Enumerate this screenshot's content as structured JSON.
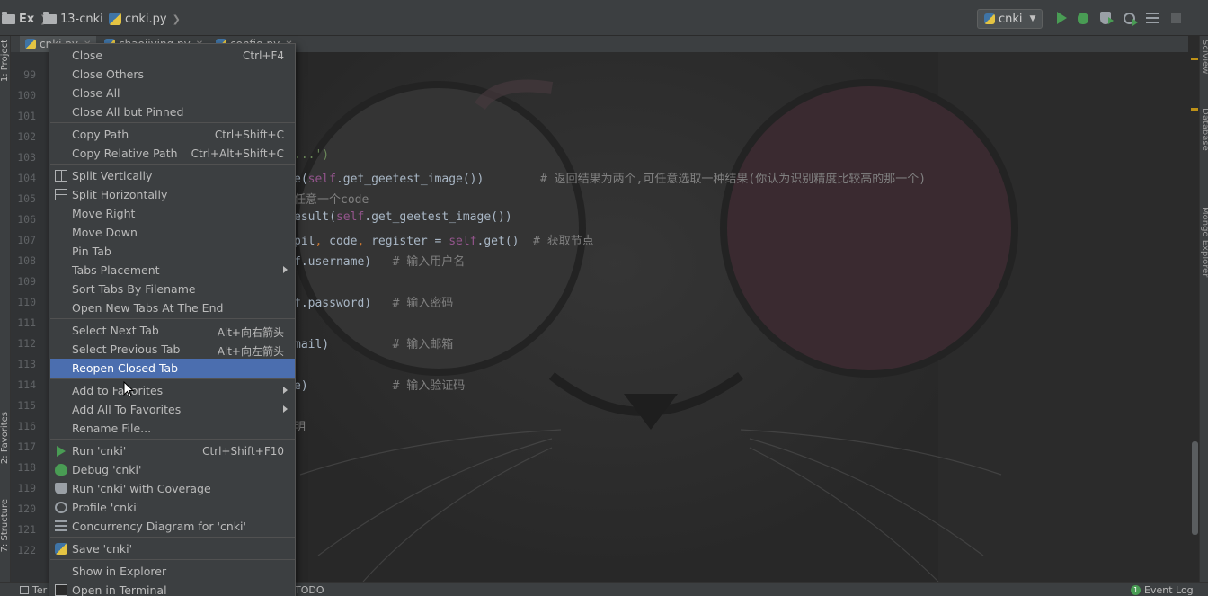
{
  "breadcrumb": [
    {
      "label": "Ex",
      "icon": "folder-icon"
    },
    {
      "label": "13-cnki",
      "icon": "folder-icon"
    },
    {
      "label": "cnki.py",
      "icon": "python-file-icon"
    }
  ],
  "toolbar": {
    "run_config": "cnki",
    "buttons": [
      "run-icon",
      "debug-icon",
      "coverage-icon",
      "profile-icon",
      "concurrency-icon",
      "stop-icon"
    ]
  },
  "tabs": [
    {
      "label": "cnki.py"
    },
    {
      "label": "chaojiying.py"
    },
    {
      "label": "config.py"
    }
  ],
  "left_tool_windows": [
    "1: Project",
    "2: Favorites",
    "7: Structure"
  ],
  "right_tool_windows": [
    "SciView",
    "Database",
    "Mongo Explorer"
  ],
  "gutter": {
    "lines": [
      "99",
      "100",
      "101",
      "102",
      "103",
      "104",
      "105",
      "106",
      "107",
      "108",
      "109",
      "110",
      "111",
      "112",
      "113",
      "114",
      "115",
      "116",
      "117",
      "118",
      "119",
      "120",
      "121",
      "122"
    ]
  },
  "code_lines": [
    {
      "parts": [
        {
          "t": "...')",
          "c": "str"
        }
      ]
    },
    {
      "parts": [
        {
          "t": "e(",
          "c": "plain"
        },
        {
          "t": "self",
          "c": "self"
        },
        {
          "t": ".get_geetest_image())        ",
          "c": "plain"
        },
        {
          "t": "# 返回结果为两个,可任意选取一种结果(你认为识别精度比较高的那一个)",
          "c": "cm"
        }
      ]
    },
    {
      "parts": [
        {
          "t": "任意一个code",
          "c": "cm"
        }
      ]
    },
    {
      "parts": [
        {
          "t": "esult(",
          "c": "plain"
        },
        {
          "t": "self",
          "c": "self"
        },
        {
          "t": ".get_geetest_image())",
          "c": "plain"
        }
      ]
    },
    {
      "parts": [
        {
          "t": "pil",
          "c": "plain"
        },
        {
          "t": ", ",
          "c": "kw"
        },
        {
          "t": "code",
          "c": "plain"
        },
        {
          "t": ", ",
          "c": "kw"
        },
        {
          "t": "register = ",
          "c": "plain"
        },
        {
          "t": "self",
          "c": "self"
        },
        {
          "t": ".get()  ",
          "c": "plain"
        },
        {
          "t": "# 获取节点",
          "c": "cm"
        }
      ]
    },
    {
      "parts": [
        {
          "t": "f.username)   ",
          "c": "plain"
        },
        {
          "t": "# 输入用户名",
          "c": "cm"
        }
      ]
    },
    {
      "parts": [
        {
          "t": "f.password)   ",
          "c": "plain"
        },
        {
          "t": "# 输入密码",
          "c": "cm"
        }
      ]
    },
    {
      "parts": [
        {
          "t": "mail)         ",
          "c": "plain"
        },
        {
          "t": "# 输入邮箱",
          "c": "cm"
        }
      ]
    },
    {
      "parts": [
        {
          "t": "e)            ",
          "c": "plain"
        },
        {
          "t": "# 输入验证码",
          "c": "cm"
        }
      ]
    },
    {
      "parts": [
        {
          "t": "明",
          "c": "cm"
        }
      ]
    }
  ],
  "context_menu": {
    "groups": [
      [
        {
          "label": "Close",
          "shortcut": "Ctrl+F4"
        },
        {
          "label": "Close Others"
        },
        {
          "label": "Close All"
        },
        {
          "label": "Close All but Pinned"
        }
      ],
      [
        {
          "label": "Copy Path",
          "shortcut": "Ctrl+Shift+C"
        },
        {
          "label": "Copy Relative Path",
          "shortcut": "Ctrl+Alt+Shift+C"
        }
      ],
      [
        {
          "label": "Split Vertically",
          "icon": "split-vertical-icon"
        },
        {
          "label": "Split Horizontally",
          "icon": "split-horizontal-icon"
        },
        {
          "label": "Move Right"
        },
        {
          "label": "Move Down"
        },
        {
          "label": "Pin Tab"
        },
        {
          "label": "Tabs Placement",
          "submenu": true
        },
        {
          "label": "Sort Tabs By Filename"
        },
        {
          "label": "Open New Tabs At The End"
        }
      ],
      [
        {
          "label": "Select Next Tab",
          "shortcut": "Alt+向右箭头"
        },
        {
          "label": "Select Previous Tab",
          "shortcut": "Alt+向左箭头"
        },
        {
          "label": "Reopen Closed Tab",
          "highlighted": true
        }
      ],
      [
        {
          "label": "Add to Favorites",
          "submenu": true
        },
        {
          "label": "Add All To Favorites",
          "submenu": true
        },
        {
          "label": "Rename File..."
        }
      ],
      [
        {
          "label": "Run 'cnki'",
          "shortcut": "Ctrl+Shift+F10",
          "icon": "run-icon"
        },
        {
          "label": "Debug 'cnki'",
          "icon": "debug-icon"
        },
        {
          "label": "Run 'cnki' with Coverage",
          "icon": "coverage-icon"
        },
        {
          "label": "Profile 'cnki'",
          "icon": "profile-icon"
        },
        {
          "label": "Concurrency Diagram for 'cnki'",
          "icon": "concurrency-icon"
        }
      ],
      [
        {
          "label": "Save 'cnki'",
          "icon": "python-file-icon"
        }
      ],
      [
        {
          "label": "Show in Explorer"
        },
        {
          "label": "Open in Terminal",
          "icon": "terminal-icon"
        }
      ]
    ]
  },
  "statusbar": {
    "left": "Ter",
    "todo": "TODO",
    "event_log": "Event Log",
    "event_count": "1"
  },
  "colors": {
    "highlight": "#4b6eaf",
    "menu_bg": "#3c3f41",
    "editor_bg": "#2b2b2b",
    "run_green": "#499c54"
  }
}
